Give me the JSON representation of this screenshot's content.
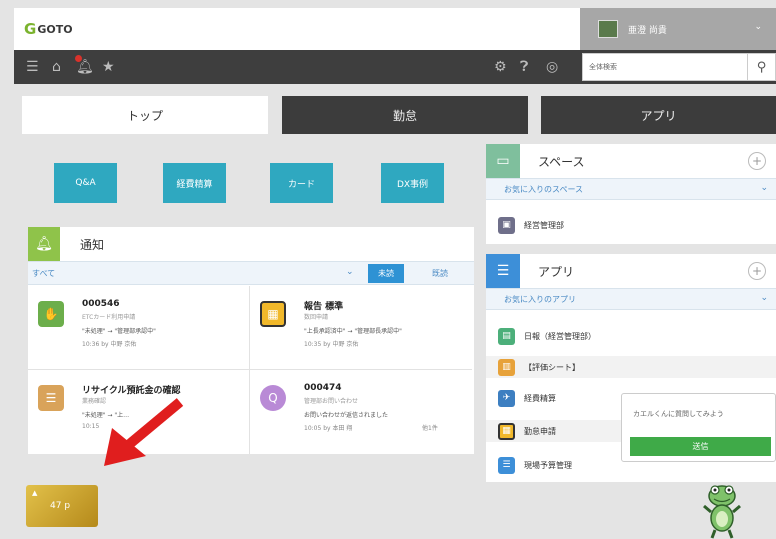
{
  "header": {
    "logo_text": "GOTO",
    "user_name": "亜澄 尚貴",
    "search_placeholder": "全体検索"
  },
  "tabs": [
    {
      "label": "トップ"
    },
    {
      "label": "勤怠"
    },
    {
      "label": "アプリ"
    }
  ],
  "quick_buttons": [
    {
      "label": "Q&A"
    },
    {
      "label": "経費精算"
    },
    {
      "label": "カード"
    },
    {
      "label": "DX事例"
    }
  ],
  "notifications": {
    "title": "通知",
    "filter_all": "すべて",
    "filter_unread": "未読",
    "filter_read": "既読",
    "items": [
      {
        "title": "000546",
        "subtitle": "ETCカード利用申請",
        "status": "\"未処理\" → \"管理部承認中\"",
        "time": "10:36 by 中野 京佑",
        "extra": ""
      },
      {
        "title": "報告 標準",
        "subtitle": "数回申請",
        "status": "\"上長承認済中\" → \"管理部長承認中\"",
        "time": "10:35 by 中野 京佑",
        "extra": ""
      },
      {
        "title": "リサイクル預託金の確認",
        "subtitle": "業務確認",
        "status": "\"未処理\" → \"上…",
        "time": "10:15",
        "extra": ""
      },
      {
        "title": "000474",
        "subtitle": "管理部お問い合わせ",
        "status": "お問い合わせが返信されました",
        "time": "10:05 by 本田 翔",
        "extra": "他1件"
      }
    ]
  },
  "space_panel": {
    "title": "スペース",
    "sub_label": "お気に入りのスペース",
    "items": [
      {
        "label": "経営管理部"
      }
    ]
  },
  "app_panel": {
    "title": "アプリ",
    "sub_label": "お気に入りのアプリ",
    "items": [
      {
        "label": "日報（経営管理部）"
      },
      {
        "label": "【評価シート】"
      },
      {
        "label": "経費精算"
      },
      {
        "label": "勤怠申請"
      },
      {
        "label": "現場予算管理"
      }
    ]
  },
  "chat": {
    "prompt": "カエルくんに質問してみよう",
    "send_label": "送信"
  },
  "points": {
    "value": "47 p"
  },
  "colors": {
    "accent_teal": "#2fa8c0",
    "notify_green": "#8fc34a",
    "panel_teal": "#7fbf9d",
    "panel_blue": "#3d8fd8",
    "send_green": "#3faa48",
    "arrow_red": "#e01e1e"
  }
}
